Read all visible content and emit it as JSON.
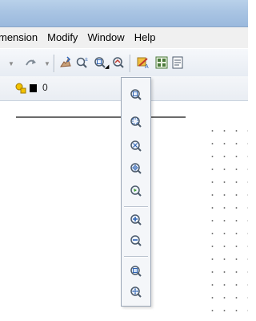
{
  "menu": {
    "items": [
      {
        "label": "mension"
      },
      {
        "label": "Modify"
      },
      {
        "label": "Window"
      },
      {
        "label": "Help"
      }
    ]
  },
  "toolbar": {
    "icons": [
      "undo-dropdown-arrow",
      "redo-icon",
      "pan-realtime-icon",
      "zoom-realtime-icon",
      "zoom-window-icon",
      "zoom-previous-icon",
      "properties-icon",
      "design-center-icon",
      "tool-palettes-icon"
    ]
  },
  "layer": {
    "name": "0",
    "swatch_color": "#000000"
  },
  "zoom_flyout": {
    "buttons": [
      "zoom-window-icon",
      "zoom-dynamic-icon",
      "zoom-scale-icon",
      "zoom-center-icon",
      "zoom-object-icon",
      "zoom-in-icon",
      "zoom-out-icon",
      "zoom-all-icon",
      "zoom-extents-icon"
    ]
  },
  "colors": {
    "titlebar": "#a9c4e3",
    "menubar": "#f0f0f0",
    "toolbar": "#e7ecf3",
    "accent_blue": "#2f64b5",
    "accent_green": "#3a9a2a"
  }
}
